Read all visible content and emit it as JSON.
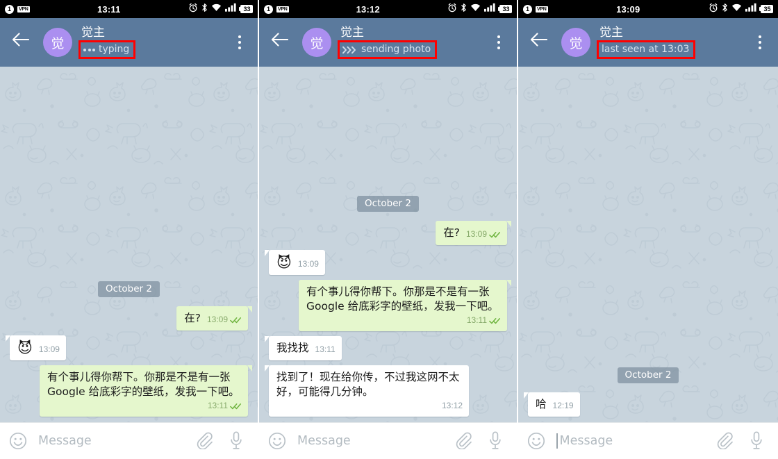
{
  "colors": {
    "appbar": "#5b7a9d",
    "avatar": "#ab8ff0",
    "chat_bg": "#c8d4dd",
    "bubble_in": "#ffffff",
    "bubble_out": "#e5f7cd",
    "annotation": "#ff0000",
    "tick_green": "#6fb43f",
    "statusbar": "#000000"
  },
  "panels": [
    {
      "id": "panel-typing",
      "statusbar": {
        "sim_badge": "1",
        "vpn_badge": "VPN",
        "clock": "13:11",
        "battery": "33",
        "icons": [
          "alarm-icon",
          "bluetooth-icon",
          "wifi-icon",
          "signal-icon",
          "battery-icon"
        ]
      },
      "header": {
        "back_label": "back-arrow",
        "avatar_initial": "觉",
        "title": "觉主",
        "substatus": "typing",
        "substatus_icon": "typing-dots-icon",
        "substatus_annotated": true,
        "menu_label": "overflow-menu"
      },
      "date_pill": "October 2",
      "messages": [
        {
          "direction": "out",
          "text": "在?",
          "time": "13:09",
          "status": "read",
          "type": "text"
        },
        {
          "direction": "in",
          "text": "😈",
          "time": "13:09",
          "type": "emoji"
        },
        {
          "direction": "out",
          "text": "有个事儿得你帮下。你那是不是有一张 Google 给底彩字的壁纸，发我一下吧。",
          "time": "13:11",
          "status": "read",
          "type": "text",
          "meta_below": true
        }
      ],
      "composer": {
        "emoji_icon": "smiley-icon",
        "placeholder": "Message",
        "caret": false,
        "attach_icon": "paperclip-icon",
        "voice_icon": "microphone-icon"
      }
    },
    {
      "id": "panel-sending-photo",
      "statusbar": {
        "sim_badge": "1",
        "vpn_badge": "VPN",
        "clock": "13:12",
        "battery": "33",
        "icons": [
          "alarm-icon",
          "bluetooth-icon",
          "wifi-icon",
          "signal-icon",
          "battery-icon"
        ]
      },
      "header": {
        "back_label": "back-arrow",
        "avatar_initial": "觉",
        "title": "觉主",
        "substatus": "sending photo",
        "substatus_icon": "chevrons-icon",
        "substatus_annotated": true,
        "menu_label": "overflow-menu"
      },
      "date_pill": "October 2",
      "messages": [
        {
          "direction": "out",
          "text": "在?",
          "time": "13:09",
          "status": "read",
          "type": "text"
        },
        {
          "direction": "in",
          "text": "😈",
          "time": "13:09",
          "type": "emoji"
        },
        {
          "direction": "out",
          "text": "有个事儿得你帮下。你那是不是有一张 Google 给底彩字的壁纸，发我一下吧。",
          "time": "13:11",
          "status": "read",
          "type": "text",
          "meta_below": true
        },
        {
          "direction": "in",
          "text": "我找找",
          "time": "13:11",
          "type": "text"
        },
        {
          "direction": "in",
          "text": "找到了！现在给你传，不过我这网不太好，可能得几分钟。",
          "time": "13:12",
          "type": "text",
          "meta_below": true
        }
      ],
      "composer": {
        "emoji_icon": "smiley-icon",
        "placeholder": "Message",
        "caret": false,
        "attach_icon": "paperclip-icon",
        "voice_icon": "microphone-icon"
      }
    },
    {
      "id": "panel-last-seen",
      "statusbar": {
        "sim_badge": "1",
        "vpn_badge": "VPN",
        "clock": "13:09",
        "battery": "35",
        "icons": [
          "alarm-icon",
          "bluetooth-icon",
          "wifi-icon",
          "signal-icon",
          "battery-icon"
        ]
      },
      "header": {
        "back_label": "back-arrow",
        "avatar_initial": "觉",
        "title": "觉主",
        "substatus": "last seen at 13:03",
        "substatus_icon": "none",
        "substatus_annotated": true,
        "menu_label": "overflow-menu"
      },
      "date_pill": "October 2",
      "messages": [
        {
          "direction": "in",
          "text": "哈",
          "time": "12:19",
          "type": "text"
        }
      ],
      "composer": {
        "emoji_icon": "smiley-icon",
        "placeholder": "Message",
        "caret": true,
        "attach_icon": "paperclip-icon",
        "voice_icon": "microphone-icon"
      }
    }
  ]
}
